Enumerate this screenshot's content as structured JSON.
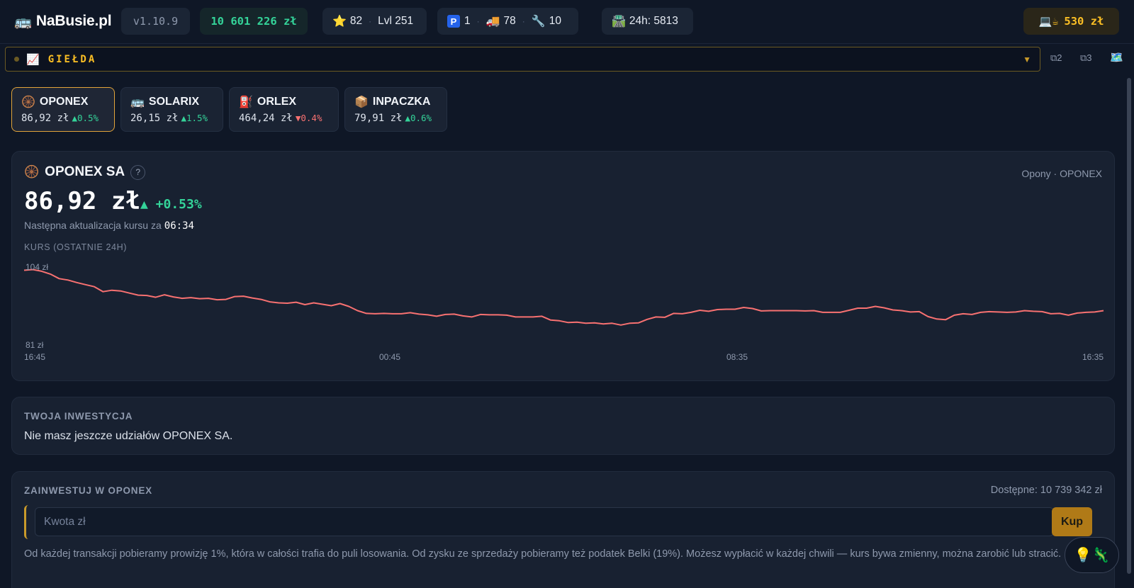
{
  "header": {
    "brand_icon": "🚌",
    "brand": "NaBusie.pl",
    "version": "v1.10.9",
    "balance": "10 601 226 zł",
    "stars": "82",
    "level": "Lvl 251",
    "parking": "1",
    "trucks": "78",
    "tools": "10",
    "income_24h": "24h: 5813",
    "wallet_icon": "💻☕",
    "wallet": "530 zł"
  },
  "gielda": {
    "icon": "📈",
    "title": "GIEŁDA",
    "extra1": "⧉2",
    "extra2": "⧉3",
    "extra3": "🗺️"
  },
  "stocks": [
    {
      "icon": "🛞",
      "name": "OPONEX",
      "price": "86,92 zł",
      "change": "▲0.5%",
      "dir": "up"
    },
    {
      "icon": "🚌",
      "name": "SOLARIX",
      "price": "26,15 zł",
      "change": "▲1.5%",
      "dir": "up"
    },
    {
      "icon": "⛽",
      "name": "ORLEX",
      "price": "464,24 zł",
      "change": "▼0.4%",
      "dir": "down"
    },
    {
      "icon": "📦",
      "name": "INPACZKA",
      "price": "79,91 zł",
      "change": "▲0.6%",
      "dir": "up"
    }
  ],
  "company": {
    "icon": "🛞",
    "name": "OPONEX SA",
    "help": "?",
    "sector": "Opony · OPONEX",
    "price": "86,92 zł",
    "change": "▲ +0.53%",
    "next_update_label": "Następna aktualizacja kursu za",
    "next_update_time": "06:34",
    "chart_label": "KURS (OSTATNIE 24H)"
  },
  "chart_data": {
    "type": "line",
    "title": "KURS (OSTATNIE 24H)",
    "ylim": [
      81,
      104
    ],
    "y_tick_labels": [
      "104 zł",
      "81 zł"
    ],
    "x_tick_labels": [
      "16:45",
      "00:45",
      "08:35",
      "16:35"
    ],
    "color": "#f87171",
    "grid": false,
    "series": [
      {
        "values": [
          102.9,
          103.1,
          102.6,
          101.8,
          100.5,
          100.1,
          99.4,
          98.8,
          98.2,
          96.8,
          97.2,
          97.0,
          96.4,
          95.8,
          95.7,
          95.2,
          95.9,
          95.3,
          94.9,
          95.1,
          94.8,
          94.9,
          94.5,
          94.6,
          95.4,
          95.5,
          95.0,
          94.6,
          93.9,
          93.6,
          93.5,
          93.8,
          93.1,
          93.6,
          93.2,
          92.8,
          93.4,
          92.6,
          91.4,
          90.6,
          90.5,
          90.6,
          90.5,
          90.5,
          90.8,
          90.4,
          90.2,
          89.8,
          90.3,
          90.4,
          89.9,
          89.6,
          90.3,
          90.2,
          90.2,
          90.1,
          89.6,
          89.6,
          89.6,
          89.8,
          88.7,
          88.5,
          88.0,
          88.1,
          87.8,
          87.9,
          87.6,
          87.8,
          87.3,
          87.8,
          87.9,
          88.9,
          89.6,
          89.5,
          90.6,
          90.5,
          90.9,
          91.5,
          91.2,
          91.7,
          91.8,
          91.8,
          92.3,
          92.0,
          91.3,
          91.4,
          91.4,
          91.4,
          91.4,
          91.3,
          91.4,
          90.9,
          90.9,
          90.9,
          91.5,
          92.1,
          92.1,
          92.6,
          92.2,
          91.6,
          91.4,
          91.0,
          91.1,
          89.7,
          89.0,
          88.8,
          90.1,
          90.5,
          90.3,
          90.9,
          91.1,
          91.0,
          90.9,
          91.0,
          91.4,
          91.2,
          91.1,
          90.5,
          90.6,
          90.1,
          90.7,
          90.9,
          91.0,
          91.4
        ]
      }
    ]
  },
  "investment": {
    "label": "TWOJA INWESTYCJA",
    "text": "Nie masz jeszcze udziałów OPONEX SA."
  },
  "buy": {
    "label": "ZAINWESTUJ W OPONEX",
    "available": "Dostępne: 10 739 342 zł",
    "placeholder": "Kwota zł",
    "button": "Kup",
    "disclaimer": "Od każdej transakcji pobieramy prowizję 1%, która w całości trafia do puli losowania. Od zysku ze sprzedaży pobieramy też podatek Belki (19%). Możesz wypłacić w każdej chwili — kurs bywa zmienny, można zarobić lub stracić."
  },
  "fab": {
    "icon": "💡🦎"
  }
}
